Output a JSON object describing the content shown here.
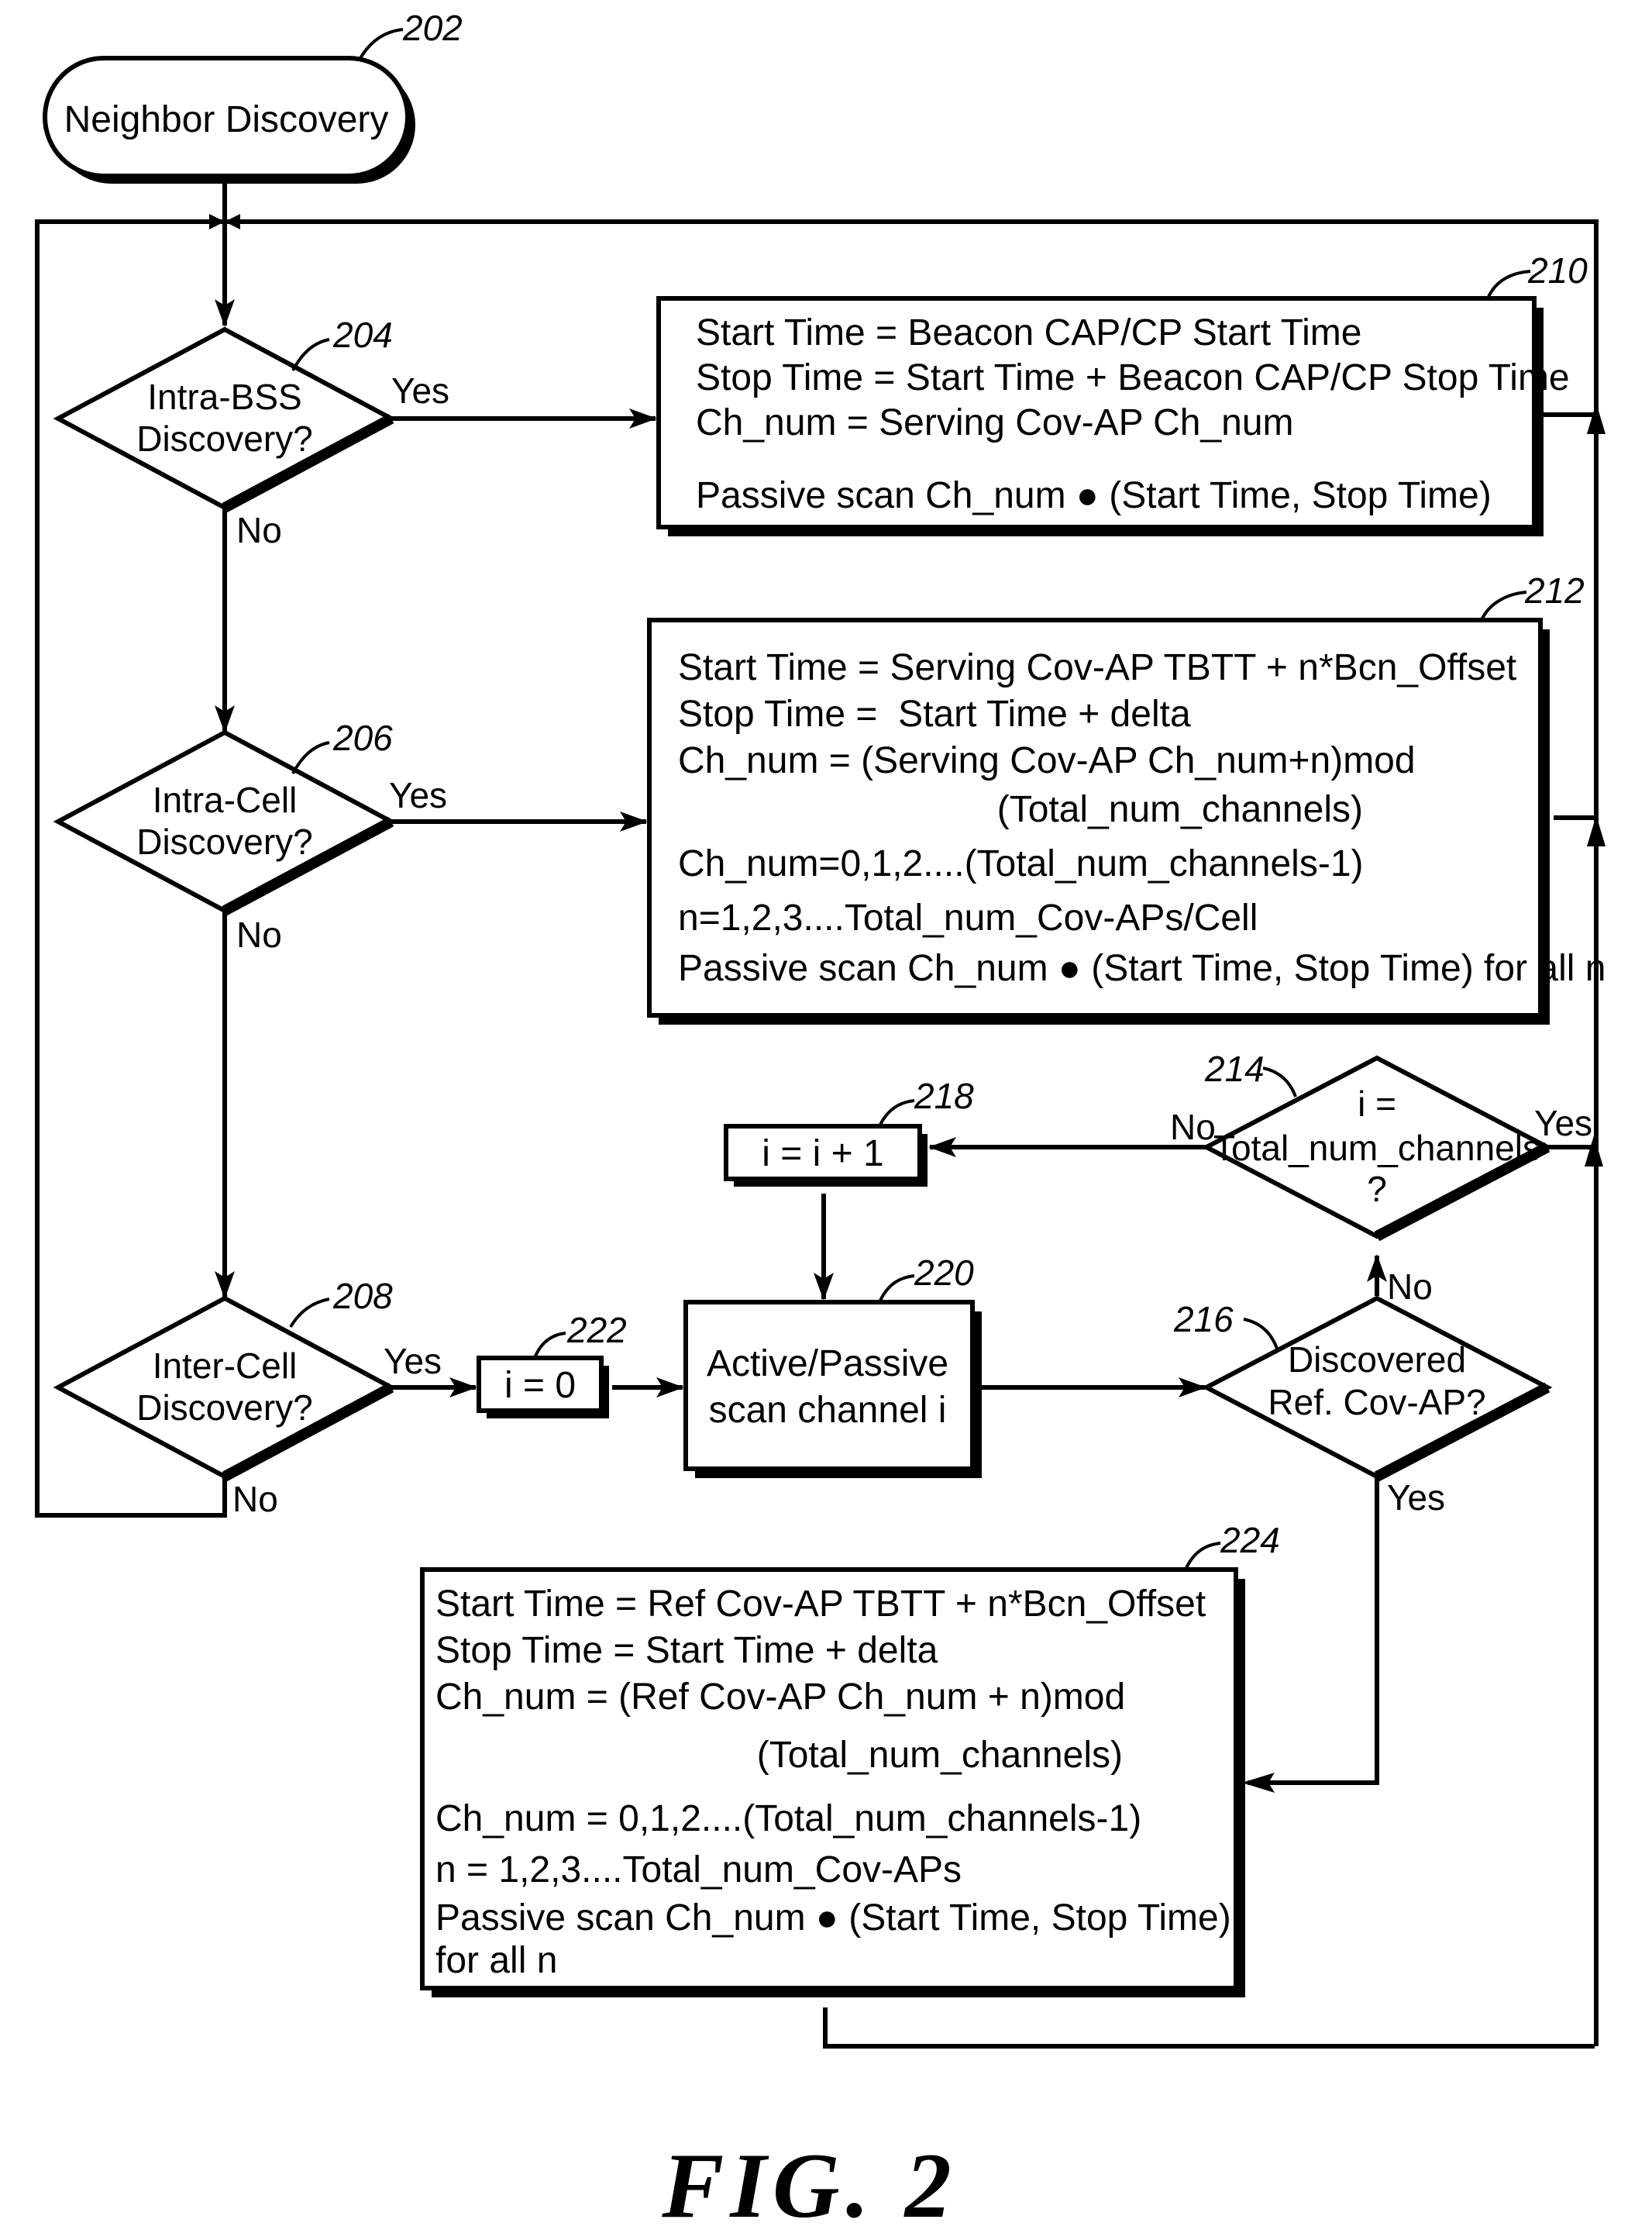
{
  "figure": {
    "caption": "FIG. 2"
  },
  "nodes": {
    "n202": {
      "ref": "202",
      "type": "terminal",
      "lines": [
        "Neighbor Discovery"
      ]
    },
    "n204": {
      "ref": "204",
      "type": "decision",
      "lines": [
        "Intra-BSS",
        "Discovery?"
      ]
    },
    "n206": {
      "ref": "206",
      "type": "decision",
      "lines": [
        "Intra-Cell",
        "Discovery?"
      ]
    },
    "n208": {
      "ref": "208",
      "type": "decision",
      "lines": [
        "Inter-Cell",
        "Discovery?"
      ]
    },
    "n210": {
      "ref": "210",
      "type": "process",
      "lines": [
        "Start Time = Beacon CAP/CP Start Time",
        "Stop Time = Start Time + Beacon CAP/CP Stop Time",
        "Ch_num = Serving Cov-AP Ch_num",
        "",
        "Passive scan Ch_num ● (Start Time, Stop Time)"
      ]
    },
    "n212": {
      "ref": "212",
      "type": "process",
      "lines": [
        "Start Time = Serving Cov-AP TBTT + n*Bcn_Offset",
        "Stop Time =  Start Time + delta",
        "Ch_num = (Serving Cov-AP Ch_num+n)mod",
        "              (Total_num_channels)",
        "Ch_num=0,1,2....(Total_num_channels-1)",
        "n=1,2,3....Total_num_Cov-APs/Cell",
        "Passive scan Ch_num ● (Start Time, Stop Time) for all n"
      ]
    },
    "n214": {
      "ref": "214",
      "type": "decision",
      "lines": [
        "i =",
        "Total_num_channels",
        "?"
      ]
    },
    "n216": {
      "ref": "216",
      "type": "decision",
      "lines": [
        "Discovered",
        "Ref. Cov-AP?"
      ]
    },
    "n218": {
      "ref": "218",
      "type": "process",
      "lines": [
        "i = i + 1"
      ]
    },
    "n220": {
      "ref": "220",
      "type": "process",
      "lines": [
        "Active/Passive",
        "scan channel i"
      ]
    },
    "n222": {
      "ref": "222",
      "type": "process",
      "lines": [
        "i = 0"
      ]
    },
    "n224": {
      "ref": "224",
      "type": "process",
      "lines": [
        "Start Time = Ref Cov-AP TBTT + n*Bcn_Offset",
        "Stop Time = Start Time + delta",
        "Ch_num = (Ref Cov-AP Ch_num + n)mod",
        "              (Total_num_channels)",
        "Ch_num = 0,1,2....(Total_num_channels-1)",
        "n = 1,2,3....Total_num_Cov-APs",
        "Passive scan Ch_num ● (Start Time, Stop Time)",
        "for all n"
      ]
    }
  },
  "edge_labels": {
    "yes": "Yes",
    "no": "No"
  },
  "edges": [
    {
      "from": "202",
      "to": "204",
      "label": ""
    },
    {
      "from": "204",
      "to": "210",
      "label": "Yes"
    },
    {
      "from": "204",
      "to": "206",
      "label": "No"
    },
    {
      "from": "206",
      "to": "212",
      "label": "Yes"
    },
    {
      "from": "206",
      "to": "208",
      "label": "No"
    },
    {
      "from": "208",
      "to": "222",
      "label": "Yes"
    },
    {
      "from": "208",
      "to": "204",
      "label": "No"
    },
    {
      "from": "222",
      "to": "220",
      "label": ""
    },
    {
      "from": "220",
      "to": "216",
      "label": ""
    },
    {
      "from": "216",
      "to": "214",
      "label": "No"
    },
    {
      "from": "216",
      "to": "224",
      "label": "Yes"
    },
    {
      "from": "214",
      "to": "218",
      "label": "No"
    },
    {
      "from": "214",
      "to": "204",
      "label": "Yes"
    },
    {
      "from": "218",
      "to": "220",
      "label": ""
    },
    {
      "from": "210",
      "to": "204",
      "label": ""
    },
    {
      "from": "212",
      "to": "204",
      "label": ""
    },
    {
      "from": "224",
      "to": "204",
      "label": ""
    }
  ]
}
